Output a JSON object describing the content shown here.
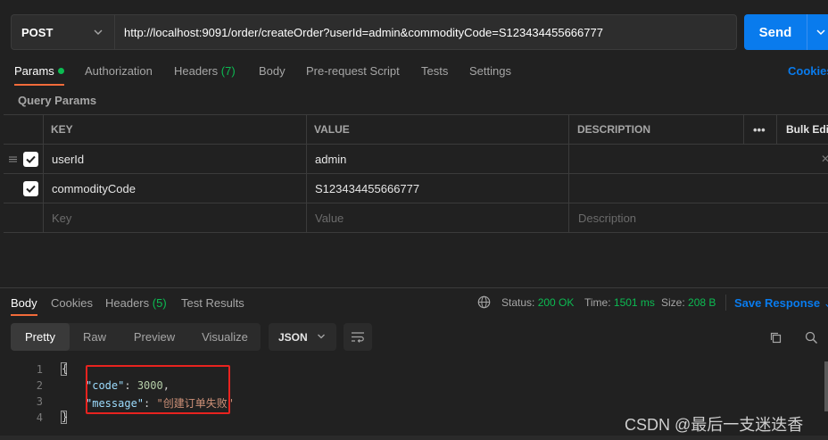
{
  "request": {
    "method": "POST",
    "url": "http://localhost:9091/order/createOrder?userId=admin&commodityCode=S123434455666777",
    "send_label": "Send"
  },
  "request_tabs": [
    {
      "label": "Params",
      "active": true
    },
    {
      "label": "Authorization"
    },
    {
      "label": "Headers",
      "count": "(7)"
    },
    {
      "label": "Body"
    },
    {
      "label": "Pre-request Script"
    },
    {
      "label": "Tests"
    },
    {
      "label": "Settings"
    }
  ],
  "cookies_label": "Cookies",
  "query_params": {
    "section_label": "Query Params",
    "headers": {
      "key": "KEY",
      "value": "VALUE",
      "description": "DESCRIPTION",
      "bulk_edit": "Bulk Edi"
    },
    "rows": [
      {
        "key": "userId",
        "value": "admin",
        "checked": true
      },
      {
        "key": "commodityCode",
        "value": "S123434455666777",
        "checked": true
      }
    ],
    "placeholders": {
      "key": "Key",
      "value": "Value",
      "description": "Description"
    }
  },
  "response": {
    "tabs": [
      {
        "label": "Body",
        "active": true
      },
      {
        "label": "Cookies"
      },
      {
        "label": "Headers",
        "count": "(5)"
      },
      {
        "label": "Test Results"
      }
    ],
    "status_label": "Status:",
    "status_value": "200 OK",
    "time_label": "Time:",
    "time_value": "1501 ms",
    "size_label": "Size:",
    "size_value": "208 B",
    "save_label": "Save Response",
    "view_modes": [
      "Pretty",
      "Raw",
      "Preview",
      "Visualize"
    ],
    "format": "JSON",
    "code": {
      "line_numbers": [
        "1",
        "2",
        "3",
        "4"
      ],
      "open_brace": "{",
      "close_brace": "}",
      "code_key": "\"code\"",
      "code_value": "3000",
      "message_key": "\"message\"",
      "message_value": "\"创建订单失败\""
    }
  },
  "watermark": "CSDN @最后一支迷迭香",
  "colors": {
    "accent": "#097bed",
    "tab_underline": "#f26b3a",
    "status_ok": "#0cbb52",
    "highlight_box": "#e8231f"
  }
}
